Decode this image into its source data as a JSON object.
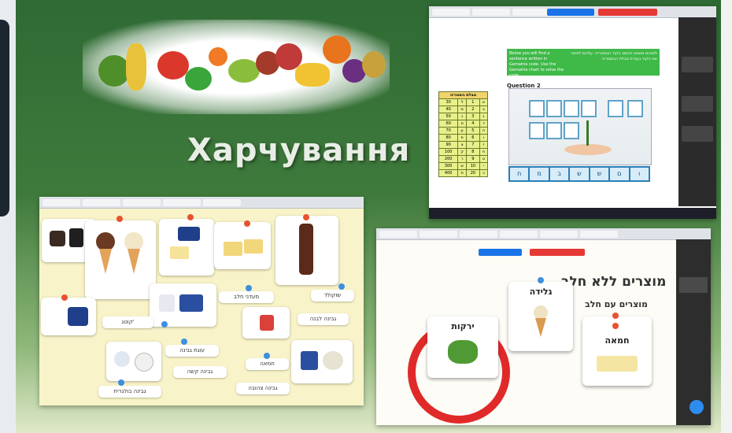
{
  "title": "Харчування",
  "panel_top": {
    "question_label": "Question 2",
    "green_left": "Below you will find a sentence written in Gematria code. Use the Gematria chart to solve the code.",
    "green_right": "לפניכם משפט הכתוב בקוד הגימטריה. עליכם לפתור את הקוד בעזרת טבלת הגימטריה",
    "cipher_title": "טבלת גימטריה",
    "cipher_rows": [
      [
        "30",
        "ל",
        "1",
        "א"
      ],
      [
        "40",
        "מ",
        "2",
        "ב"
      ],
      [
        "50",
        "נ",
        "3",
        "ג"
      ],
      [
        "60",
        "ס",
        "4",
        "ד"
      ],
      [
        "70",
        "ע",
        "5",
        "ה"
      ],
      [
        "80",
        "פ",
        "6",
        "ו"
      ],
      [
        "90",
        "צ",
        "7",
        "ז"
      ],
      [
        "100",
        "ק",
        "8",
        "ח"
      ],
      [
        "200",
        "ר",
        "9",
        "ט"
      ],
      [
        "300",
        "ש",
        "10",
        "י"
      ],
      [
        "400",
        "ת",
        "20",
        "כ"
      ]
    ],
    "letters": [
      "ח",
      "מ",
      "ב",
      "ש",
      "ש",
      "ם",
      "ו"
    ]
  },
  "panel_left": {
    "labels": [
      "שוקולד",
      "מעדני חלב",
      "גבינה לבנה",
      "קוטג'",
      "גבינה קשה",
      "עוגת גבינה",
      "חמאה",
      "גבינה צהובה",
      "גבינה בולגרית"
    ]
  },
  "panel_right": {
    "heading_right": "מוצרים ללא חלב",
    "heading_left": "מוצרים עם חלב",
    "card_vegetables": "ירקות",
    "card_icecream": "גלידה",
    "card_butter": "חמאה"
  },
  "colors": {
    "bg_green": "#3f7a3c",
    "accent_green": "#3fb948",
    "accent_blue": "#2a7fb8",
    "dot_red": "#e8512f",
    "dot_blue": "#3d8fe0"
  }
}
